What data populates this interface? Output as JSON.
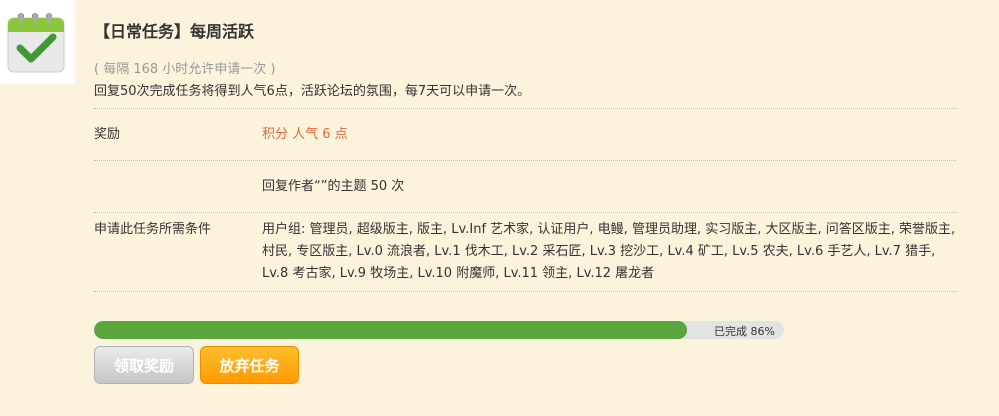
{
  "task": {
    "icon": "calendar-check-icon",
    "title": "【日常任务】每周活跃",
    "interval": "( 每隔 168 小时允许申请一次 )",
    "description": "回复50次完成任务将得到人气6点，活跃论坛的氛围，每7天可以申请一次。"
  },
  "reward": {
    "label": "奖励",
    "value": "积分 人气 6 点"
  },
  "requirement": {
    "value": "回复作者“”的主题 50 次"
  },
  "conditions": {
    "label": "申请此任务所需条件",
    "value": "用户组: 管理员, 超级版主, 版主, Lv.Inf 艺术家, 认证用户, 电鳗, 管理员助理, 实习版主, 大区版主, 问答区版主, 荣誉版主, 村民, 专区版主, Lv.0 流浪者, Lv.1 伐木工, Lv.2 采石匠, Lv.3 挖沙工, Lv.4 矿工, Lv.5 农夫, Lv.6 手艺人, Lv.7 猎手, Lv.8 考古家, Lv.9 牧场主, Lv.10 附魔师, Lv.11 领主, Lv.12 屠龙者"
  },
  "progress": {
    "percent": 86,
    "text": "已完成 86%"
  },
  "buttons": {
    "claim": "领取奖励",
    "abandon": "放弃任务"
  },
  "colors": {
    "background": "#fcf3dc",
    "reward": "#e8663a",
    "progress": "#5aa63c",
    "abandon": "#ff9a00"
  }
}
